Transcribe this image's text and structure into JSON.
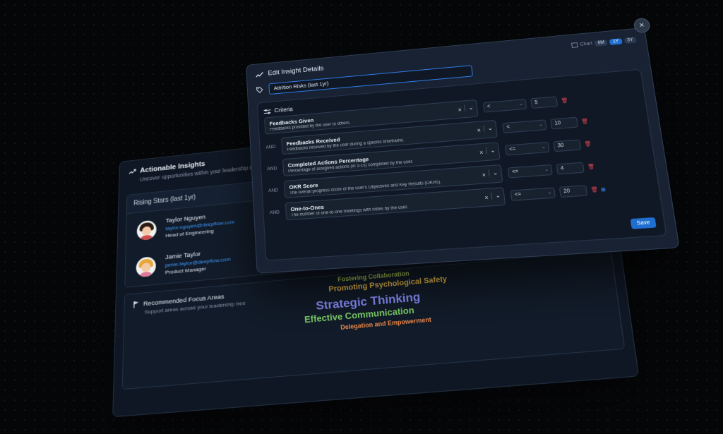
{
  "insights": {
    "title": "Actionable Insights",
    "subtitle": "Uncover opportunities within your leadership tree",
    "rising_stars": {
      "title": "Rising Stars (last 1yr)",
      "people": [
        {
          "name": "Taylor Nguyen",
          "email": "taylor.nguyen@deepflow.com",
          "role": "Head of Engineering",
          "hair_color": "#2a1a12",
          "shirt_color": "#d04a4a"
        },
        {
          "name": "Jamie Taylor",
          "email": "jamie.taylor@deepflow.com",
          "role": "Product Manager",
          "hair_color": "#e8a73a",
          "shirt_color": "#e07a9a"
        }
      ]
    },
    "focus_areas": {
      "title": "Recommended Focus Areas",
      "subtitle": "Support areas across your leadership tree",
      "words": [
        "Fostering Collaboration",
        "Promoting Psychological Safety",
        "Strategic Thinking",
        "Effective Communication",
        "Delegation and Empowerment"
      ]
    }
  },
  "modal": {
    "title": "Edit Insight Details",
    "chart_label": "Chart",
    "ranges": [
      "6M",
      "1Y",
      "3Y"
    ],
    "active_range": "1Y",
    "insight_name": "Attrition Risks (last 1yr)",
    "criteria_label": "Criteria",
    "and_label": "AND",
    "criteria": [
      {
        "title": "Feedbacks Given",
        "desc": "Feedbacks provided by the user to others.",
        "op": "<",
        "value": "5"
      },
      {
        "title": "Feedbacks Received",
        "desc": "Feedbacks received by the user during a specific timeframe.",
        "op": "<",
        "value": "10"
      },
      {
        "title": "Completed Actions Percentage",
        "desc": "Percentage of assigned actions (in 1-1s) completed by the user.",
        "op": "<=",
        "value": "30"
      },
      {
        "title": "OKR Score",
        "desc": "The overall progress score of the user's Objectives and Key Results (OKRs).",
        "op": "<=",
        "value": "4"
      },
      {
        "title": "One-to-Ones",
        "desc": "The number of one-to-one meetings with notes by the user.",
        "op": "<=",
        "value": "20"
      }
    ],
    "save_label": "Save",
    "close_glyph": "×",
    "clear_glyph": "×",
    "chevron_glyph": "⌄",
    "trash_glyph": "🗑",
    "add_glyph": "⊕",
    "colors": {
      "accent": "#1f6fd0",
      "danger": "#e0464e",
      "link": "#3f9bff"
    }
  }
}
